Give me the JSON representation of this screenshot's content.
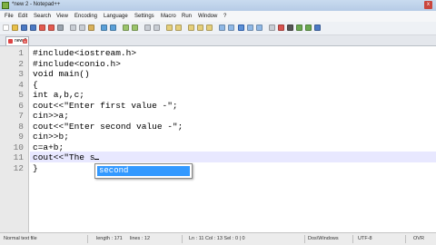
{
  "window": {
    "title": "*new 2 - Notepad++",
    "close_glyph": "x"
  },
  "menu": {
    "items": [
      "File",
      "Edit",
      "Search",
      "View",
      "Encoding",
      "Language",
      "Settings",
      "Macro",
      "Run",
      "Window",
      "?"
    ]
  },
  "tab": {
    "label": "new 2",
    "close_glyph": "x"
  },
  "editor": {
    "line_numbers": [
      "1",
      "2",
      "3",
      "4",
      "5",
      "6",
      "7",
      "8",
      "9",
      "10",
      "11",
      "12"
    ],
    "lines": [
      "#include<iostream.h>",
      "#include<conio.h>",
      "void main()",
      "{",
      "int a,b,c;",
      "cout<<\"Enter first value -\";",
      "cin>>a;",
      "cout<<\"Enter second value -\";",
      "cin>>b;",
      "c=a+b;",
      "cout<<\"The s",
      "}"
    ],
    "current_line": 11
  },
  "autocomplete": {
    "suggestion": "second"
  },
  "status": {
    "file_type": "Normal text file",
    "length": "length : 171",
    "lines": "lines : 12",
    "position": "Ln : 11   Col : 13   Sel : 0 | 0",
    "eol": "Dos\\Windows",
    "encoding": "UTF-8",
    "mode": "OVR"
  },
  "colors": {
    "selection": "#3399ff",
    "current_line": "#e8e8ff",
    "line_number": "#7a7a7a"
  }
}
